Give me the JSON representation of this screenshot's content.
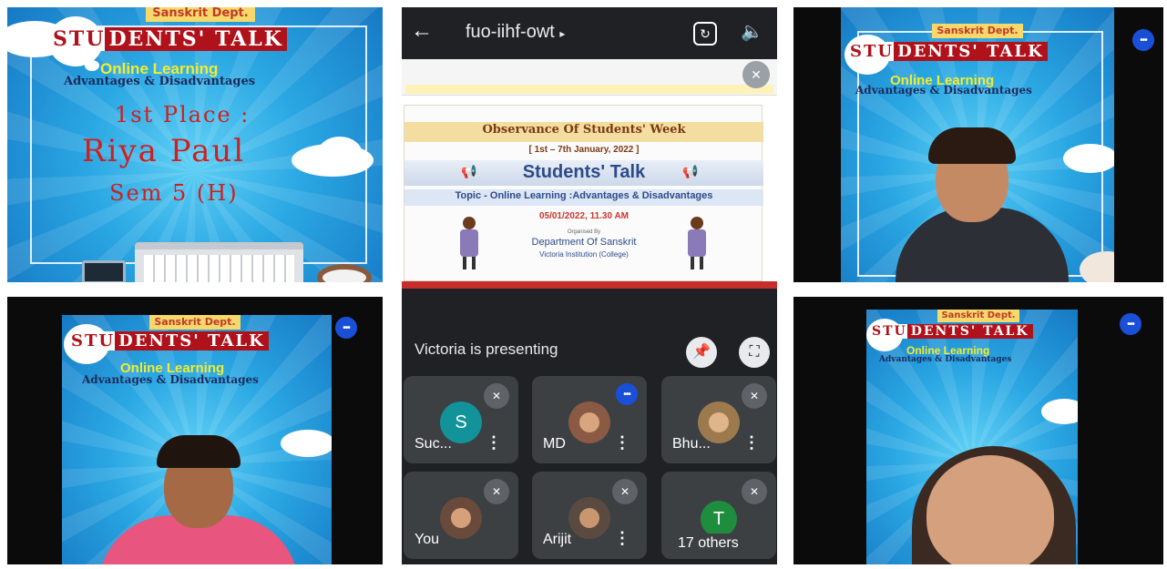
{
  "left_poster": {
    "dept": "Sanskrit Dept.",
    "title_stu": "STU",
    "title_rest": "DENTS' TALK",
    "topic": "Online Learning",
    "subtopic": "Advantages & Disadvantages",
    "place": "1st Place :",
    "winner": "Riya Paul",
    "semester": "Sem 5 (H)"
  },
  "meet": {
    "meeting_code": "fuo-iihf-owt",
    "presenting_text": "Victoria is presenting",
    "slide": {
      "observance": "Observance Of Students' Week",
      "dates": "[ 1st – 7th January, 2022 ]",
      "talk": "Students' Talk",
      "topic": "Topic - Online Learning :Advantages & Disadvantages",
      "datetime": "05/01/2022, 11.30 AM",
      "organised": "Organised By",
      "department": "Department Of Sanskrit",
      "institution": "Victoria Institution (College)"
    },
    "participants": [
      {
        "name": "Suc...",
        "initial": "S",
        "avatar_color": "#12939a"
      },
      {
        "name": "MD",
        "initial": "",
        "avatar_color": "#8a5a44"
      },
      {
        "name": "Bhu...",
        "initial": "",
        "avatar_color": "#9c7a4e"
      },
      {
        "name": "You",
        "initial": "",
        "avatar_color": "#6a4a3a"
      },
      {
        "name": "Arijit",
        "initial": "",
        "avatar_color": "#5a4a40"
      },
      {
        "name": "17 others",
        "initial": "T",
        "avatar_color": "#1e8e3e"
      }
    ]
  },
  "video_tiles": {
    "dept": "Sanskrit Dept.",
    "title_stu": "STU",
    "title_rest": "DENTS' TALK",
    "topic": "Online Learning",
    "subtopic": "Advantages & Disadvantages"
  },
  "icons": {
    "back": "arrow-left-icon",
    "switch_camera": "camera-switch-icon",
    "speaker": "speaker-icon",
    "pin": "pin-icon",
    "fullscreen": "fullscreen-icon",
    "mic_off": "mic-off-icon",
    "talking": "speaking-indicator-icon"
  },
  "colors": {
    "meet_dark": "#202124",
    "tile": "#3c4043",
    "accent_blue": "#1a4fd8",
    "poster_red": "#b0121b",
    "poster_yellow": "#f4ec2b"
  }
}
